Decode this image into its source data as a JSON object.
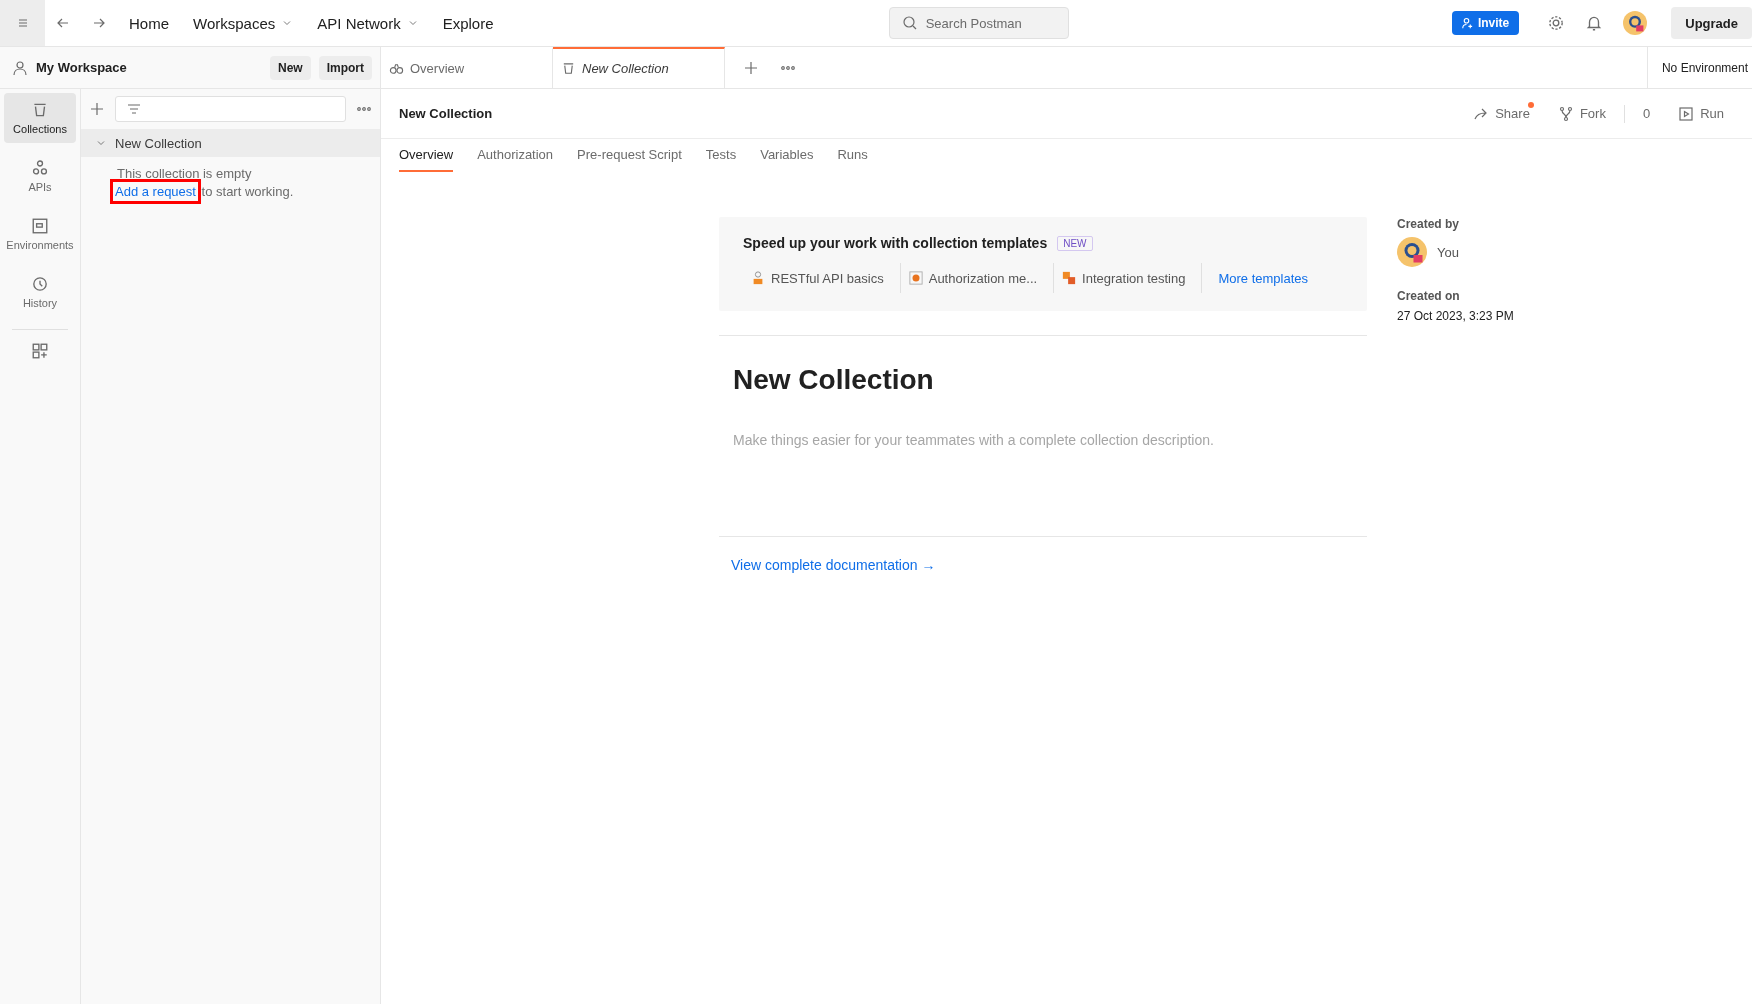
{
  "topbar": {
    "nav": [
      {
        "label": "Home",
        "dropdown": false
      },
      {
        "label": "Workspaces",
        "dropdown": true
      },
      {
        "label": "API Network",
        "dropdown": true
      },
      {
        "label": "Explore",
        "dropdown": false
      }
    ],
    "search": {
      "placeholder": "Search Postman"
    },
    "invite": "Invite",
    "upgrade": "Upgrade"
  },
  "workspace": {
    "name": "My Workspace",
    "buttons": [
      "New",
      "Import"
    ]
  },
  "rail": [
    {
      "label": "Collections",
      "kind": "collections",
      "selected": true
    },
    {
      "label": "APIs",
      "kind": "apis",
      "selected": false
    },
    {
      "label": "Environments",
      "kind": "environments",
      "selected": false
    },
    {
      "label": "History",
      "kind": "history",
      "selected": false
    }
  ],
  "tree": {
    "name": "New Collection",
    "expanded": true,
    "empty_text": "This collection is empty",
    "link": "Add a request",
    "link_highlighted": true,
    "after_link": "to start working."
  },
  "tabs": [
    {
      "label": "Overview",
      "selected": false,
      "kind": "overview"
    },
    {
      "label": "New Collection",
      "selected": true,
      "kind": "collection"
    }
  ],
  "environment": "No Environment",
  "header": {
    "title": "New Collection",
    "share": "Share",
    "share_dot": true,
    "fork": "Fork",
    "fork_count": "0",
    "run": "Run"
  },
  "subtabs": [
    {
      "label": "Overview",
      "selected": true
    },
    {
      "label": "Authorization",
      "selected": false
    },
    {
      "label": "Pre-request Script",
      "selected": false
    },
    {
      "label": "Tests",
      "selected": false
    },
    {
      "label": "Variables",
      "selected": false
    },
    {
      "label": "Runs",
      "selected": false
    }
  ],
  "templates": {
    "title": "Speed up your work with collection templates",
    "badge": "NEW",
    "items": [
      "RESTful API basics",
      "Authorization me...",
      "Integration testing"
    ],
    "more": "More templates"
  },
  "doc": {
    "title": "New Collection",
    "placeholder": "Make things easier for your teammates with a complete collection description.",
    "link": "View complete documentation →"
  },
  "meta": {
    "created_by_label": "Created by",
    "created_by": "You",
    "created_on_label": "Created on",
    "created_on": "27 Oct 2023, 3:23 PM"
  }
}
